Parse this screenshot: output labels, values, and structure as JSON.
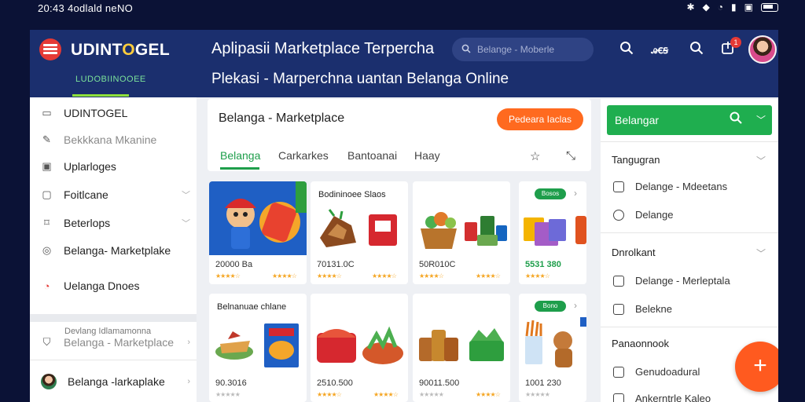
{
  "status_bar": {
    "time": "20:43 4odlald neNO"
  },
  "header": {
    "brand_prefix": "UDINT",
    "brand_o": "O",
    "brand_suffix": "GEL",
    "sub_brand": "LUDOBIINOOEE",
    "title": "Aplipasii Marketplace Terpercha",
    "subtitle": "Plekasi - Marperchna uantan Belanga Online",
    "search_placeholder": "Belange - Moberle",
    "icon_label": "ꭿꞓꞩ",
    "notification_count": "1"
  },
  "sidebar": {
    "items": [
      {
        "label": "UDINTOGEL",
        "icon": "window-icon"
      },
      {
        "label": "Bekkkana Mkanine",
        "icon": "pencil-icon"
      },
      {
        "label": "Uplarloges",
        "icon": "image-icon"
      },
      {
        "label": "Foitlcane",
        "icon": "card-icon"
      },
      {
        "label": "Beterlops",
        "icon": "tag-icon"
      },
      {
        "label": "Belanga- Marketplake",
        "icon": "location-icon"
      },
      {
        "label": "Uelanga Dnoes",
        "icon": "chart-icon"
      },
      {
        "label": "Belanga - Marketplace",
        "icon": "shield-icon"
      },
      {
        "label": "Belanga -larkaplake",
        "icon": "avatar"
      }
    ],
    "subtitle": "Devlang Idlamamonna"
  },
  "center": {
    "title": "Belanga - Marketplace",
    "action_button": "Pedeara Iaclas",
    "tabs": [
      "Belanga",
      "Carkarkes",
      "Bantoanai",
      "Haay"
    ],
    "cards": [
      {
        "price": "20000 Ba",
        "caption": ""
      },
      {
        "price": "70131.0C",
        "caption": "Bodininoee Slaos"
      },
      {
        "price": "50R010C",
        "caption": ""
      },
      {
        "price": "5531 380",
        "pill": "Bosos"
      },
      {
        "price": "",
        "caption": "Belnanuae chlane"
      },
      {
        "price": "2510.500",
        "caption": ""
      },
      {
        "price": "90011.500",
        "caption": ""
      },
      {
        "price": "1001 230",
        "pill": "Bono"
      }
    ],
    "card_row2_first_price": "90.3016"
  },
  "right_panel": {
    "search_label": "Belangar",
    "sections": [
      {
        "title": "Tangugran",
        "items": [
          "Delange - Mdeetans",
          "Delange"
        ]
      },
      {
        "title": "Dnrolkant",
        "items": [
          "Delange - Merleptala",
          "Belekne"
        ]
      },
      {
        "title": "Panaonnook",
        "items": [
          "Genudoadural",
          "Ankerntrle Kaleo"
        ]
      }
    ]
  },
  "colors": {
    "header": "#1b2f6e",
    "accent_green": "#1fae4f",
    "accent_orange": "#ff6a1f"
  }
}
